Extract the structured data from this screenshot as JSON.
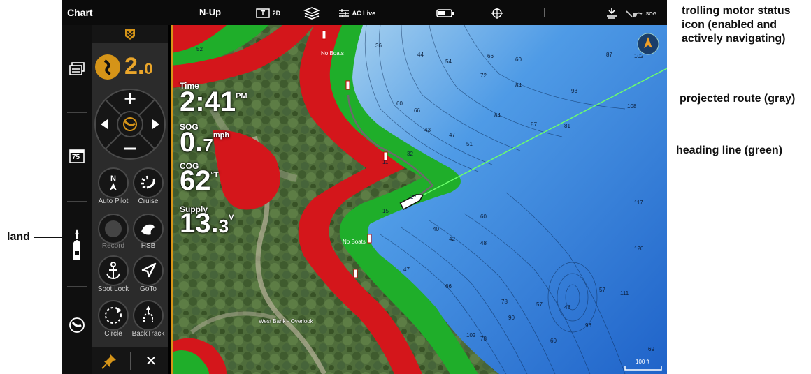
{
  "topbar": {
    "title": "Chart",
    "orientation": "N-Up",
    "view_mode": "2D",
    "live_label": "AC Live",
    "sog_label": "SOG"
  },
  "overlays": {
    "time": {
      "label": "Time",
      "value": "2:41",
      "unit": "PM"
    },
    "sog": {
      "label": "SOG",
      "value": "0.",
      "value_small": "7",
      "unit": "mph"
    },
    "cog": {
      "label": "COG",
      "value": "62",
      "unit": "°T"
    },
    "supply": {
      "label": "Supply",
      "value": "13.",
      "value_small": "3",
      "unit": "V"
    }
  },
  "panel": {
    "speed_value": "2.",
    "speed_small": "0",
    "buttons": [
      {
        "label": "Auto Pilot"
      },
      {
        "label": "Cruise"
      },
      {
        "label": "Record"
      },
      {
        "label": "HSB"
      },
      {
        "label": "Spot Lock"
      },
      {
        "label": "GoTo"
      },
      {
        "label": "Circle"
      },
      {
        "label": "BackTrack"
      }
    ],
    "plus": "+",
    "minus": "−",
    "close": "✕"
  },
  "leftrail": {
    "temp_label": "75"
  },
  "map": {
    "labels": {
      "no_boats_1": "No Boats",
      "no_boats_2": "No Boats",
      "overlook": "West Bank - Overlook",
      "scale": "100 ft"
    },
    "depths": [
      {
        "t": "52"
      },
      {
        "t": "36"
      },
      {
        "t": "44"
      },
      {
        "t": "54"
      },
      {
        "t": "66"
      },
      {
        "t": "60"
      },
      {
        "t": "72"
      },
      {
        "t": "84"
      },
      {
        "t": "93"
      },
      {
        "t": "87"
      },
      {
        "t": "102"
      },
      {
        "t": "108"
      },
      {
        "t": "60"
      },
      {
        "t": "66"
      },
      {
        "t": "84"
      },
      {
        "t": "87"
      },
      {
        "t": "81"
      },
      {
        "t": "43"
      },
      {
        "t": "47"
      },
      {
        "t": "51"
      },
      {
        "t": "32"
      },
      {
        "t": "11"
      },
      {
        "t": "27"
      },
      {
        "t": "15"
      },
      {
        "t": "40"
      },
      {
        "t": "60"
      },
      {
        "t": "42"
      },
      {
        "t": "48"
      },
      {
        "t": "47"
      },
      {
        "t": "66"
      },
      {
        "t": "78"
      },
      {
        "t": "90"
      },
      {
        "t": "57"
      },
      {
        "t": "48"
      },
      {
        "t": "117"
      },
      {
        "t": "120"
      },
      {
        "t": "111"
      },
      {
        "t": "102"
      },
      {
        "t": "78"
      },
      {
        "t": "96"
      },
      {
        "t": "57"
      },
      {
        "t": "60"
      },
      {
        "t": "69"
      }
    ]
  },
  "callouts": {
    "trolling": "trolling motor status icon (enabled and actively navigating)",
    "route": "projected route (gray)",
    "heading": "heading line (green)",
    "land": "land"
  },
  "colors": {
    "accent": "#d59418",
    "shallow": "#d4161b",
    "mid": "#1fae2a",
    "water": "#3b8be0",
    "heading": "#6cff6c"
  }
}
